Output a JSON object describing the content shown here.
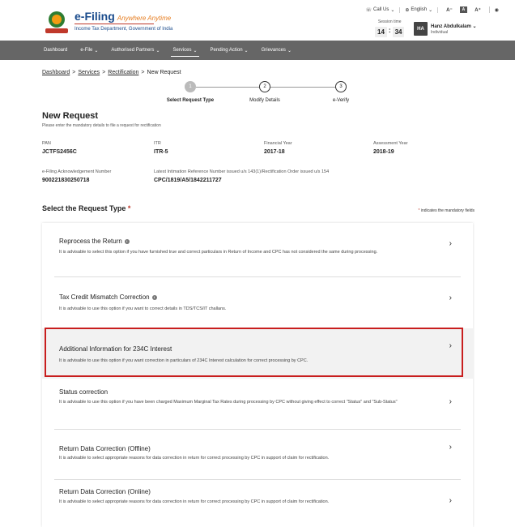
{
  "header": {
    "brand_title": "e-Filing",
    "brand_tagline": "Anywhere Anytime",
    "brand_sub": "Income Tax Department, Government of India",
    "call_us": "Call Us",
    "language": "English",
    "font_small": "A⁻",
    "font_normal": "A",
    "font_large": "A⁺",
    "session_label": "Session time",
    "session_min": "14",
    "session_sep": ":",
    "session_sec": "34",
    "user_initials": "HA",
    "user_name": "Hanz Abdulkalam",
    "user_role": "Individual"
  },
  "nav": {
    "items": [
      {
        "label": "Dashboard",
        "chev": ""
      },
      {
        "label": "e-File",
        "chev": "⌄"
      },
      {
        "label": "Authorised Partners",
        "chev": "⌄"
      },
      {
        "label": "Services",
        "chev": "⌄"
      },
      {
        "label": "Pending Action",
        "chev": "⌄"
      },
      {
        "label": "Grievances",
        "chev": "⌄"
      }
    ]
  },
  "breadcrumb": {
    "dashboard": "Dashboard",
    "services": "Services",
    "rectification": "Rectification",
    "current": "New Request",
    "sep": ">"
  },
  "stepper": {
    "steps": [
      {
        "num": "1",
        "label": "Select Request Type"
      },
      {
        "num": "2",
        "label": "Modify Details"
      },
      {
        "num": "3",
        "label": "e-Verify"
      }
    ]
  },
  "page": {
    "title": "New Request",
    "subtitle": "Please enter the mandatory details to file a request for rectification"
  },
  "details": {
    "pan_label": "PAN",
    "pan": "JCTFS2456C",
    "itr_label": "ITR",
    "itr": "ITR-5",
    "fy_label": "Financial Year",
    "fy": "2017-18",
    "ay_label": "Assessment Year",
    "ay": "2018-19",
    "ack_label": "e-Filing Acknowledgement Number",
    "ack": "900221830250718",
    "ref_label": "Latest Intimation Reference Number issued u/s 143(1)/Rectification Order issued u/s 154",
    "ref": "CPC/1819/A5/1842211727"
  },
  "section": {
    "title": "Select the Request Type",
    "star": "*",
    "mandatory_note": "indicates the mandatory fields"
  },
  "options": [
    {
      "title": "Reprocess the Return",
      "desc": "It is advisable to select this option if you have furnished true and correct particulars in Return of Income and CPC has not considered the same during processing."
    },
    {
      "title": "Tax Credit Mismatch Correction",
      "desc": "It is advisable to use this option if you want to correct details in TDS/TCS/IT challans."
    },
    {
      "title": "Additional Information for 234C Interest",
      "desc": "It is advisable to use this option if you want correction in particulars of 234C Interest calculation for correct processing by CPC."
    },
    {
      "title": "Status correction",
      "desc": "It is advisable to use this option if you have been charged Maximum Marginal Tax Rates during processing by CPC without giving effect to correct \"Status\" and \"Sub-Status\""
    },
    {
      "title": "Return Data Correction (Offline)",
      "desc": "It is advisable to select appropriate reasons for data correction in return for correct processing by CPC in support of claim for rectification."
    },
    {
      "title": "Return Data Correction (Online)",
      "desc": "It is advisable to select appropriate reasons for data correction in return for correct processing by CPC in support of claim for rectification."
    }
  ],
  "colors": {
    "highlight_border": "#c81e1e",
    "nav_bg": "#666666"
  }
}
